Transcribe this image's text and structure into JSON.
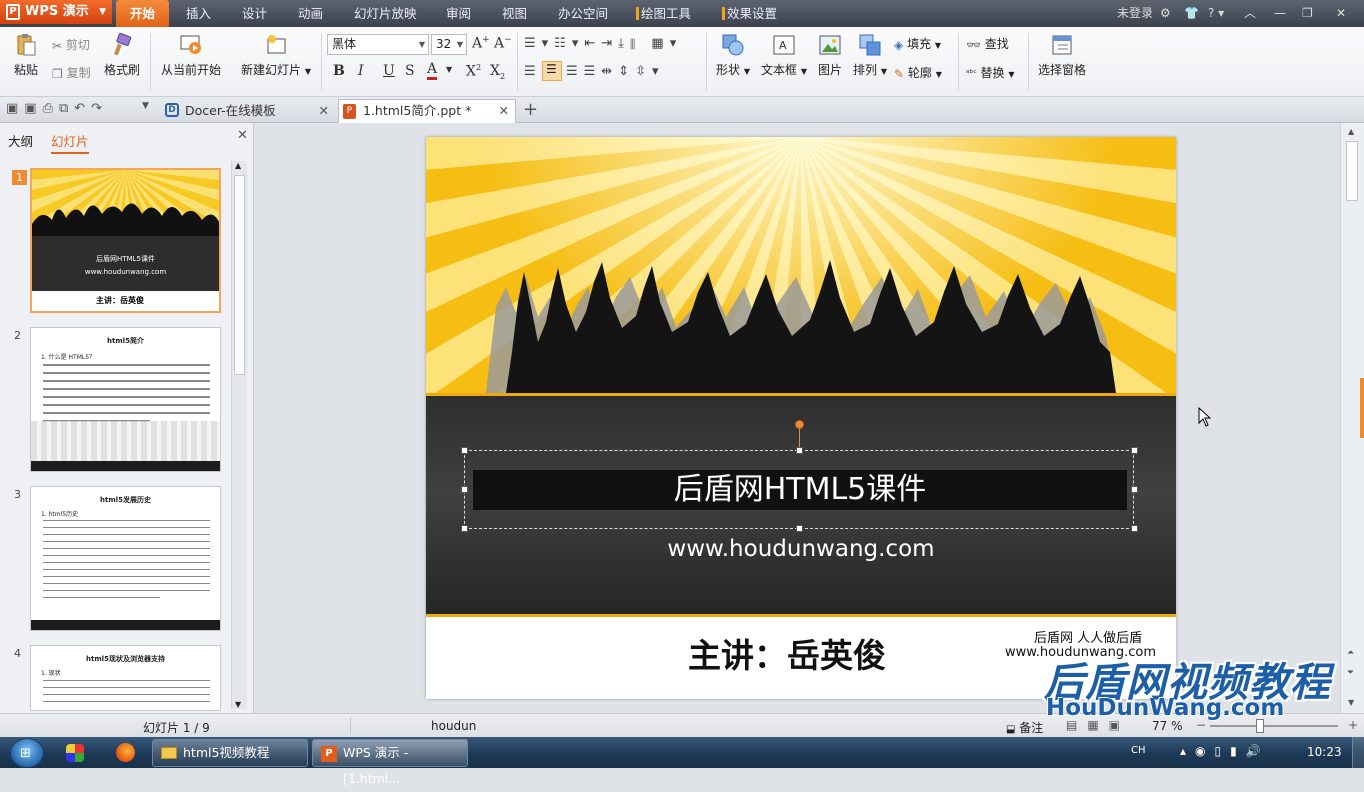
{
  "app": {
    "name": "WPS 演示",
    "menu": [
      "开始",
      "插入",
      "设计",
      "动画",
      "幻灯片放映",
      "审阅",
      "视图",
      "办公空间",
      "绘图工具",
      "效果设置"
    ],
    "active_menu": "开始",
    "login": "未登录"
  },
  "ribbon": {
    "paste": "粘贴",
    "cut": "剪切",
    "copy": "复制",
    "format_painter": "格式刷",
    "from_current": "从当前开始",
    "new_slide": "新建幻灯片",
    "font_name": "黑体",
    "font_size": "32",
    "shape": "形状",
    "textbox": "文本框",
    "picture": "图片",
    "arrange": "排列",
    "fill": "填充",
    "outline": "轮廓",
    "find": "查找",
    "replace": "替换",
    "selection_pane": "选择窗格"
  },
  "tabs": [
    {
      "label": "Docer-在线模板"
    },
    {
      "label": "1.html5简介.ppt *"
    }
  ],
  "left_panel": {
    "tab_outline": "大纲",
    "tab_slides": "幻灯片",
    "thumbs": [
      {
        "num": "1",
        "title": "后盾网HTML5课件",
        "url": "www.houdunwang.com",
        "speaker": "主讲：岳英俊"
      },
      {
        "num": "2",
        "title": "html5简介",
        "line1": "1. 什么是 HTML5？"
      },
      {
        "num": "3",
        "title": "html5发展历史",
        "line1": "1. html5历史"
      },
      {
        "num": "4",
        "title": "html5现状及浏览器支持",
        "line1": "1. 现状"
      }
    ]
  },
  "slide": {
    "title": "后盾网HTML5课件",
    "url": "www.houdunwang.com",
    "speaker": "主讲：岳英俊",
    "corner_line1": "后盾网 人人做后盾",
    "corner_line2": "www.houdunwang.com"
  },
  "watermark": {
    "line1": "后盾网视频教程",
    "line2": "HouDunWang.com"
  },
  "status": {
    "slide_counter": "幻灯片 1 / 9",
    "author": "houdun",
    "notes": "备注",
    "zoom": "77 %"
  },
  "taskbar": {
    "items": [
      "html5视频教程",
      "WPS 演示 - [1.html..."
    ],
    "ime": "CH",
    "clock": "10:23"
  },
  "colors": {
    "accent": "#e06318",
    "slide_yellow": "#f5b80d",
    "slide_dark": "#333333",
    "watermark_blue": "#1c5fa8"
  }
}
